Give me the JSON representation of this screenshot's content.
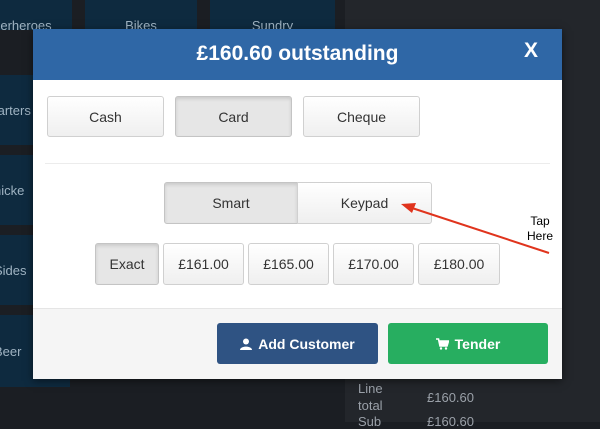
{
  "background": {
    "top_tiles": [
      "erheroes",
      "Bikes",
      "Sundry"
    ],
    "left_tiles": [
      "tarters",
      "hicke",
      "Sides",
      "Beer"
    ],
    "line_total_label": "Line total",
    "line_total_value": "£160.60",
    "cut_label": "Sub",
    "cut_value": "£160.60"
  },
  "modal": {
    "title": "£160.60 outstanding",
    "close_label": "X",
    "payment_methods": [
      "Cash",
      "Card",
      "Cheque"
    ],
    "input_modes": [
      "Smart",
      "Keypad"
    ],
    "amounts": [
      "Exact",
      "£161.00",
      "£165.00",
      "£170.00",
      "£180.00"
    ],
    "add_customer_label": "Add Customer",
    "tender_label": "Tender"
  },
  "annotation": {
    "line1": "Tap",
    "line2": "Here",
    "arrow_color": "#e0341d"
  },
  "colors": {
    "header": "#2f67a6",
    "add_customer": "#2f5383",
    "tender": "#27ae60"
  }
}
